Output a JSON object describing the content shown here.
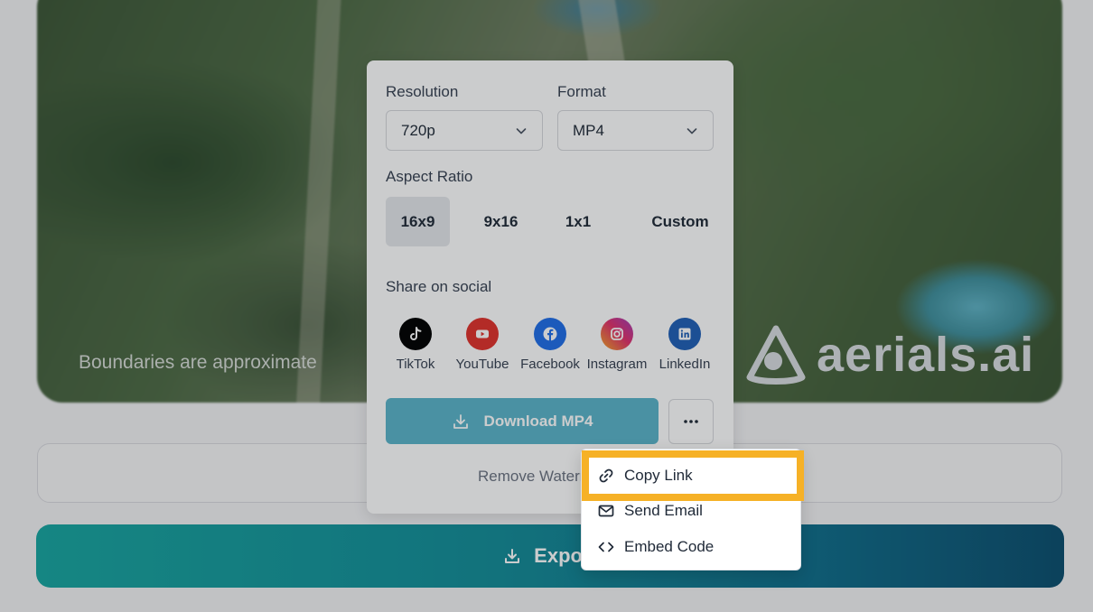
{
  "background": {
    "watermark_note": "Boundaries are approximate",
    "brand": "aerials.ai",
    "export_button_label": "Export"
  },
  "popover": {
    "resolution": {
      "label": "Resolution",
      "value": "720p"
    },
    "format": {
      "label": "Format",
      "value": "MP4"
    },
    "aspect_ratio": {
      "label": "Aspect Ratio",
      "options": [
        "16x9",
        "9x16",
        "1x1",
        "Custom"
      ],
      "selected": "16x9"
    },
    "share": {
      "label": "Share on social",
      "networks": [
        {
          "name": "TikTok",
          "icon": "tiktok-icon",
          "color": "#000000"
        },
        {
          "name": "YouTube",
          "icon": "youtube-icon",
          "color": "#e0312b"
        },
        {
          "name": "Facebook",
          "icon": "facebook-icon",
          "color": "#1f6ee8"
        },
        {
          "name": "Instagram",
          "icon": "instagram-icon",
          "color": "#e1306c"
        },
        {
          "name": "LinkedIn",
          "icon": "linkedin-icon",
          "color": "#1f5fb6"
        }
      ]
    },
    "download_label": "Download MP4",
    "more_icon": "ellipsis-icon",
    "remove_watermark_label": "Remove Watermark"
  },
  "dropdown": {
    "items": [
      {
        "label": "Copy Link",
        "icon": "link-icon"
      },
      {
        "label": "Send Email",
        "icon": "mail-icon"
      },
      {
        "label": "Embed Code",
        "icon": "code-icon"
      }
    ],
    "highlighted": "Copy Link",
    "highlight_color": "#f6b126"
  },
  "colors": {
    "accent_teal": "#17a6a0",
    "accent_blue": "#0b4e6e",
    "download_button": "#5ab4c9"
  }
}
